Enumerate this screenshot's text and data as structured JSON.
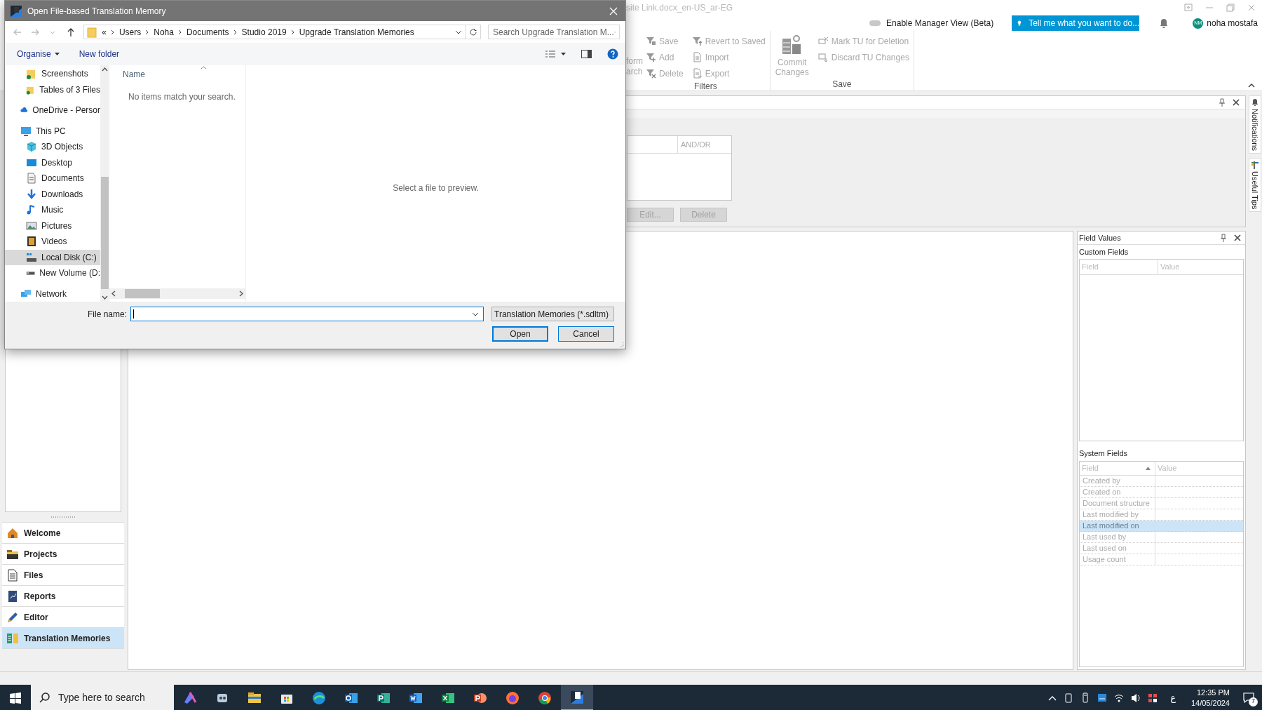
{
  "app": {
    "title_fragment": "site Link.docx_en-US_ar-EG",
    "manager_view": {
      "label": "Enable Manager View (Beta)",
      "on": false
    },
    "tell_me": "Tell me what you want to do...",
    "user": {
      "initials": "NM",
      "name": "noha mostafa"
    }
  },
  "ribbon": {
    "fragments": [
      "form",
      "arch"
    ],
    "groups": [
      {
        "label": "Filters",
        "columns": [
          [
            {
              "label": "Save",
              "kind": "filter-save",
              "disabled": true
            },
            {
              "label": "Add",
              "kind": "filter-add",
              "disabled": true
            },
            {
              "label": "Delete",
              "kind": "filter-delete",
              "disabled": true
            }
          ],
          [
            {
              "label": "Revert to Saved",
              "kind": "filter-revert",
              "disabled": true
            },
            {
              "label": "Import",
              "kind": "import",
              "disabled": true
            },
            {
              "label": "Export",
              "kind": "export",
              "disabled": true
            }
          ]
        ]
      },
      {
        "label": "Save",
        "large": {
          "label": "Commit Changes",
          "disabled": true
        },
        "columns": [
          [
            {
              "label": "Mark TU for Deletion",
              "kind": "mark",
              "disabled": true
            },
            {
              "label": "Discard TU Changes",
              "kind": "discard",
              "disabled": true
            }
          ]
        ]
      }
    ]
  },
  "filter_panel": {
    "column": "AND/OR",
    "buttons": [
      {
        "label": "Edit...",
        "disabled": true
      },
      {
        "label": "Delete",
        "disabled": true
      }
    ]
  },
  "side_tabs": [
    {
      "label": "Notifications",
      "kind": "bell"
    },
    {
      "label": "Useful Tips",
      "kind": "tips"
    }
  ],
  "nav": [
    {
      "label": "Welcome",
      "kind": "home",
      "selected": false
    },
    {
      "label": "Projects",
      "kind": "projects",
      "selected": false
    },
    {
      "label": "Files",
      "kind": "files",
      "selected": false
    },
    {
      "label": "Reports",
      "kind": "reports",
      "selected": false
    },
    {
      "label": "Editor",
      "kind": "editor",
      "selected": false
    },
    {
      "label": "Translation Memories",
      "kind": "tm",
      "selected": true
    }
  ],
  "field_values": {
    "title": "Field Values",
    "custom": {
      "title": "Custom Fields",
      "columns": [
        "Field",
        "Value"
      ]
    },
    "system": {
      "title": "System Fields",
      "columns": [
        "Field",
        "Value"
      ],
      "rows": [
        {
          "field": "Created by",
          "selected": false
        },
        {
          "field": "Created on",
          "selected": false
        },
        {
          "field": "Document structure",
          "selected": false
        },
        {
          "field": "Last modified by",
          "selected": false
        },
        {
          "field": "Last modified on",
          "selected": true
        },
        {
          "field": "Last used by",
          "selected": false
        },
        {
          "field": "Last used on",
          "selected": false
        },
        {
          "field": "Usage count",
          "selected": false
        }
      ]
    }
  },
  "dialog": {
    "title": "Open File-based Translation Memory",
    "path": [
      "«",
      "Users",
      "Noha",
      "Documents",
      "Studio 2019",
      "Upgrade Translation Memories"
    ],
    "search_placeholder": "Search Upgrade Translation M...",
    "toolbar": [
      "Organise",
      "New folder"
    ],
    "tree": [
      {
        "label": "Screenshots",
        "kind": "folder-synced",
        "selected": false
      },
      {
        "label": "Tables of 3 Files",
        "kind": "folder-synced",
        "selected": false
      },
      {
        "label": "OneDrive - Persor",
        "kind": "cloud",
        "selected": false
      },
      {
        "label": "This PC",
        "kind": "pc",
        "selected": false,
        "children": [
          {
            "label": "3D Objects",
            "kind": "cube",
            "selected": false
          },
          {
            "label": "Desktop",
            "kind": "desktop",
            "selected": false
          },
          {
            "label": "Documents",
            "kind": "documents",
            "selected": false
          },
          {
            "label": "Downloads",
            "kind": "downloads",
            "selected": false
          },
          {
            "label": "Music",
            "kind": "music",
            "selected": false
          },
          {
            "label": "Pictures",
            "kind": "pictures",
            "selected": false
          },
          {
            "label": "Videos",
            "kind": "videos",
            "selected": false
          },
          {
            "label": "Local Disk (C:)",
            "kind": "disk",
            "selected": true
          },
          {
            "label": "New Volume (D:",
            "kind": "drive",
            "selected": false
          }
        ]
      },
      {
        "label": "Network",
        "kind": "network",
        "selected": false
      }
    ],
    "column": "Name",
    "empty_message": "No items match your search.",
    "preview_message": "Select a file to preview.",
    "file_name": {
      "label": "File name:"
    },
    "file_type": "Translation Memories (*.sdltm)",
    "buttons": [
      {
        "label": "Open",
        "default": true
      },
      {
        "label": "Cancel",
        "default": false
      }
    ]
  },
  "taskbar": {
    "search_placeholder": "Type here to search",
    "apps": [
      {
        "kind": "copilot",
        "active": false
      },
      {
        "kind": "robot",
        "active": false
      },
      {
        "kind": "explorer",
        "active": false
      },
      {
        "kind": "store",
        "active": false
      },
      {
        "kind": "edge",
        "active": false
      },
      {
        "kind": "outlook",
        "active": false
      },
      {
        "kind": "publisher",
        "active": false
      },
      {
        "kind": "word",
        "active": false
      },
      {
        "kind": "excel",
        "active": false
      },
      {
        "kind": "powerpoint",
        "active": false
      },
      {
        "kind": "firefox",
        "active": false
      },
      {
        "kind": "chrome",
        "active": false
      },
      {
        "kind": "studio",
        "active": true
      }
    ],
    "language": "ع",
    "time": "12:35 PM",
    "date": "14/05/2024",
    "notifications": "7"
  }
}
